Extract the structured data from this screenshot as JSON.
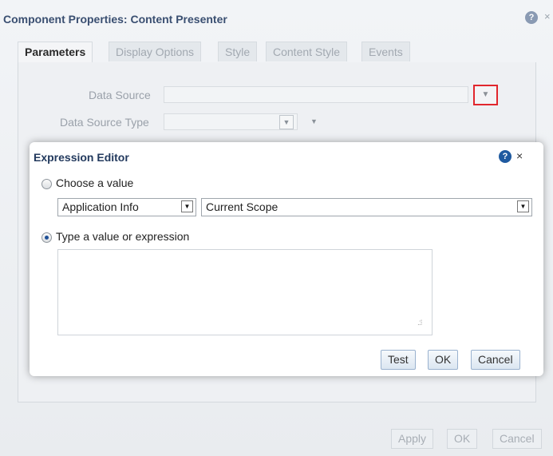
{
  "background_dialog": {
    "title": "Component Properties: Content Presenter",
    "help_glyph": "?",
    "close_glyph": "×",
    "tabs": [
      {
        "label": "Parameters",
        "active": true
      },
      {
        "label": "Display Options",
        "active": false
      },
      {
        "label": "Style",
        "active": false
      },
      {
        "label": "Content Style",
        "active": false
      },
      {
        "label": "Events",
        "active": false
      }
    ],
    "fields": {
      "data_source_label": "Data Source",
      "data_source_value": "",
      "data_source_type_label": "Data Source Type",
      "data_source_type_value": ""
    },
    "buttons": {
      "apply": "Apply",
      "ok": "OK",
      "cancel": "Cancel"
    }
  },
  "expression_editor": {
    "title": "Expression Editor",
    "help_glyph": "?",
    "close_glyph": "×",
    "choose_value_label": "Choose a value",
    "choose_value_selected": false,
    "select_category": "Application Info",
    "select_scope": "Current Scope",
    "type_expression_label": "Type a value or expression",
    "type_expression_selected": true,
    "expression_value": "",
    "buttons": {
      "test": "Test",
      "ok": "OK",
      "cancel": "Cancel"
    }
  },
  "icons": {
    "help": "help-circle-icon",
    "close": "close-icon",
    "dropdown": "chevron-down-icon",
    "resize": "resize-grip-icon"
  },
  "colors": {
    "title_text": "#3a4f71",
    "modal_title_text": "#233a5e",
    "help_icon": "#1f5aa0",
    "highlight_box": "#e1262d"
  }
}
